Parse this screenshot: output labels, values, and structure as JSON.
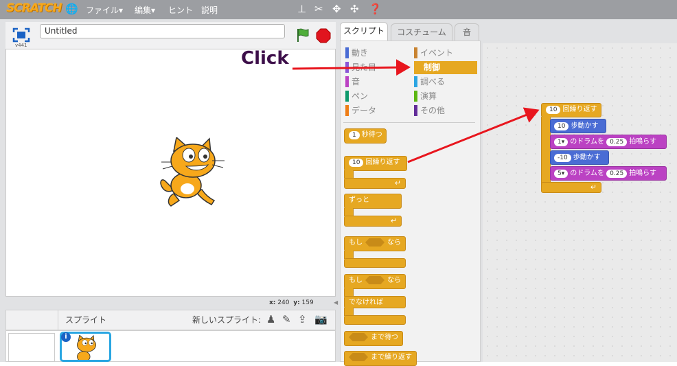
{
  "menubar": {
    "logo": "SCRATCH",
    "file": "ファイル▾",
    "edit": "編集▾",
    "tips": "ヒント",
    "about": "説明"
  },
  "stage": {
    "version": "v441",
    "project_title": "Untitled",
    "x_label": "x:",
    "x_value": "240",
    "y_label": "y:",
    "y_value": "159"
  },
  "sprites": {
    "label": "スプライト",
    "new_sprite": "新しいスプライト:",
    "info": "i"
  },
  "tabs": [
    "スクリプト",
    "コスチューム",
    "音"
  ],
  "categories": {
    "motion": {
      "label": "動き",
      "color": "#4a6cd4"
    },
    "looks": {
      "label": "見た目",
      "color": "#8a55d7"
    },
    "sound": {
      "label": "音",
      "color": "#bb42c3"
    },
    "pen": {
      "label": "ペン",
      "color": "#0e9a6c"
    },
    "data": {
      "label": "データ",
      "color": "#ee7d16"
    },
    "events": {
      "label": "イベント",
      "color": "#c88330"
    },
    "control": {
      "label": "制御",
      "color": "#e6a822"
    },
    "sensing": {
      "label": "調べる",
      "color": "#2ca5e2"
    },
    "operators": {
      "label": "演算",
      "color": "#5cb712"
    },
    "more": {
      "label": "その他",
      "color": "#632d99"
    }
  },
  "palette": {
    "wait": {
      "num": "1",
      "text": "秒待つ"
    },
    "repeat": {
      "num": "10",
      "text": "回繰り返す"
    },
    "forever": "ずっと",
    "if": "もし",
    "then": "なら",
    "if2": "もし",
    "then2": "なら",
    "else": "でなければ",
    "wait_until": "まで待つ",
    "repeat_until": "まで繰り返す"
  },
  "script": {
    "repeat_num": "10",
    "repeat_text": "回繰り返す",
    "move1_num": "10",
    "move1_text": "歩動かす",
    "drum1_num": "1▾",
    "drum1_text": "のドラムを",
    "drum1_beats": "0.25",
    "drum1_end": "拍鳴らす",
    "move2_num": "-10",
    "move2_text": "歩動かす",
    "drum2_num": "5▾",
    "drum2_text": "のドラムを",
    "drum2_beats": "0.25",
    "drum2_end": "拍鳴らす"
  },
  "annotation": {
    "click": "Click",
    "arrow_color": "#e8161e"
  }
}
